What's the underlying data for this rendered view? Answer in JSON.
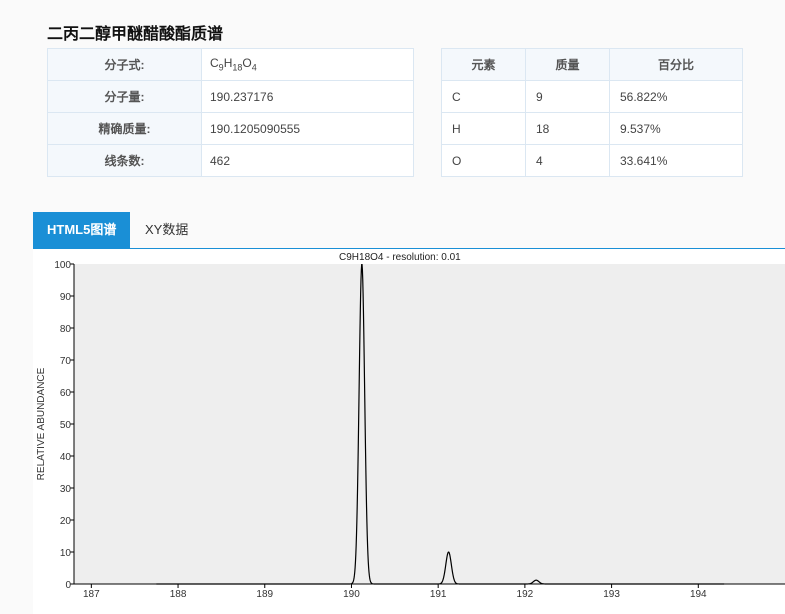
{
  "page": {
    "title": "二丙二醇甲醚醋酸酯质谱"
  },
  "properties": [
    {
      "label": "分子式:",
      "value": "",
      "formula": [
        "C",
        "9",
        "H",
        "18",
        "O",
        "4"
      ]
    },
    {
      "label": "分子量:",
      "value": "190.237176"
    },
    {
      "label": "精确质量:",
      "value": "190.1205090555"
    },
    {
      "label": "线条数:",
      "value": "462"
    }
  ],
  "composition": {
    "headers": [
      "元素",
      "质量",
      "百分比"
    ],
    "rows": [
      [
        "C",
        "9",
        "56.822%"
      ],
      [
        "H",
        "18",
        "9.537%"
      ],
      [
        "O",
        "4",
        "33.641%"
      ]
    ]
  },
  "tabs": [
    {
      "label": "HTML5图谱",
      "active": true
    },
    {
      "label": "XY数据",
      "active": false
    }
  ],
  "chart_data": {
    "type": "line",
    "title": "C9H18O4 - resolution: 0.01",
    "ylabel": "RELATIVE ABUNDANCE",
    "xlabel": "",
    "xlim": [
      186.8,
      195.0
    ],
    "ylim": [
      0,
      100
    ],
    "x_ticks": [
      187,
      188,
      189,
      190,
      191,
      192,
      193,
      194
    ],
    "y_ticks": [
      0,
      10,
      20,
      30,
      40,
      50,
      60,
      70,
      80,
      90,
      100
    ],
    "grid": false,
    "peaks": [
      {
        "mz": 190.12,
        "abundance": 100
      },
      {
        "mz": 191.12,
        "abundance": 10
      },
      {
        "mz": 192.13,
        "abundance": 1.2
      }
    ],
    "plot_background": "#eeeeee",
    "line_color": "#000000"
  },
  "colors": {
    "accent": "#1a8fd6",
    "table_border": "#dbe7f2",
    "header_bg": "#f4f8fc"
  }
}
